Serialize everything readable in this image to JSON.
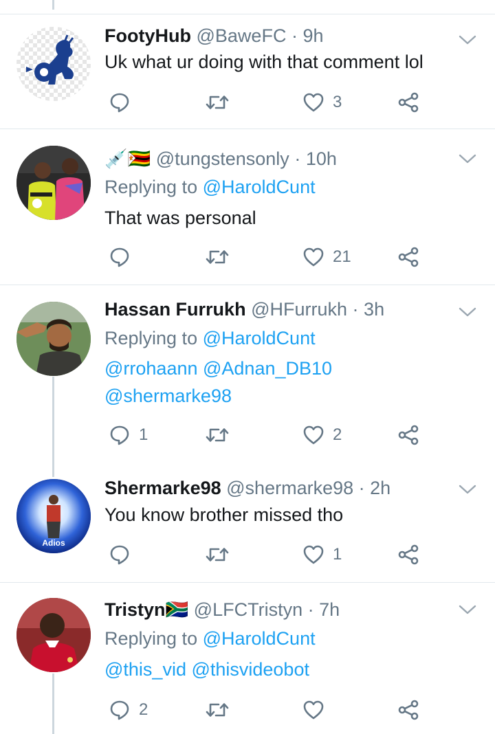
{
  "tweets": [
    {
      "name": "FootyHub",
      "handle": "@BaweFC",
      "time": "9h",
      "text": "Uk what ur doing with that comment lol",
      "reply_count": "",
      "retweet_count": "",
      "like_count": "3",
      "avatar_icon": "chelsea-lion-crest"
    },
    {
      "name": "",
      "name_emoji": "💉🇿🇼",
      "handle": "@tungstensonly",
      "time": "10h",
      "replying_label": "Replying to",
      "replying_to": "@HaroldCunt",
      "text": "That was personal",
      "reply_count": "",
      "retweet_count": "",
      "like_count": "21",
      "avatar_icon": "footballers-photo"
    },
    {
      "name": "Hassan Furrukh",
      "handle": "@HFurrukh",
      "time": "3h",
      "replying_label": "Replying to",
      "replying_to": "@HaroldCunt",
      "mentions_line1": "@rrohaann @Adnan_DB10",
      "mentions_line2": "@shermarke98",
      "reply_count": "1",
      "retweet_count": "",
      "like_count": "2",
      "avatar_icon": "man-saluting-photo"
    },
    {
      "name": "Shermarke98",
      "handle": "@shermarke98",
      "time": "2h",
      "text": "You know brother missed tho",
      "reply_count": "",
      "retweet_count": "",
      "like_count": "1",
      "avatar_icon": "adios-portal-photo",
      "avatar_caption": "Adios"
    },
    {
      "name": "Tristyn",
      "name_emoji": "🇿🇦",
      "handle": "@LFCTristyn",
      "time": "7h",
      "replying_label": "Replying to",
      "replying_to": "@HaroldCunt",
      "mentions_line1": "@this_vid @thisvideobot",
      "reply_count": "2",
      "retweet_count": "",
      "like_count": "",
      "avatar_icon": "liverpool-player-photo"
    }
  ],
  "colors": {
    "link": "#1da1f2",
    "meta": "#657786",
    "divider": "#e1e8ed",
    "thread_line": "#ccd6dd"
  },
  "separator": "·"
}
